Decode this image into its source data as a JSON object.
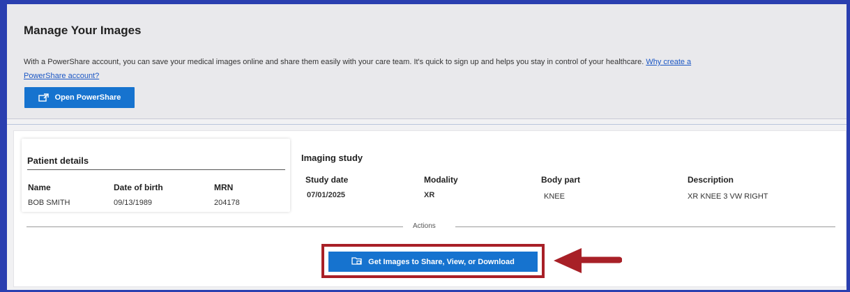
{
  "manage": {
    "title": "Manage Your Images",
    "description": "With a PowerShare account, you can save your medical images online and share them easily with your care team. It's quick to sign up and helps you stay in control of your healthcare.",
    "link_text": "Why create a PowerShare account?",
    "open_button_label": "Open PowerShare",
    "open_button_icon": "open-external-icon"
  },
  "patient": {
    "title": "Patient details",
    "name_label": "Name",
    "name_value": "BOB SMITH",
    "dob_label": "Date of birth",
    "dob_value": "09/13/1989",
    "mrn_label": "MRN",
    "mrn_value": "204178"
  },
  "imaging": {
    "title": "Imaging study",
    "study_date_label": "Study date",
    "study_date_value": "07/01/2025",
    "modality_label": "Modality",
    "modality_value": "XR",
    "body_part_label": "Body part",
    "body_part_value": "KNEE",
    "description_label": "Description",
    "description_value": "XR KNEE 3 VW RIGHT"
  },
  "actions": {
    "label": "Actions",
    "get_images_label": "Get Images to Share, View, or Download",
    "get_images_icon": "folder-share-icon"
  },
  "colors": {
    "frame_border": "#2a3fb0",
    "button_blue": "#1673cf",
    "highlight_red": "#a82027",
    "link_blue": "#1a56c4"
  }
}
